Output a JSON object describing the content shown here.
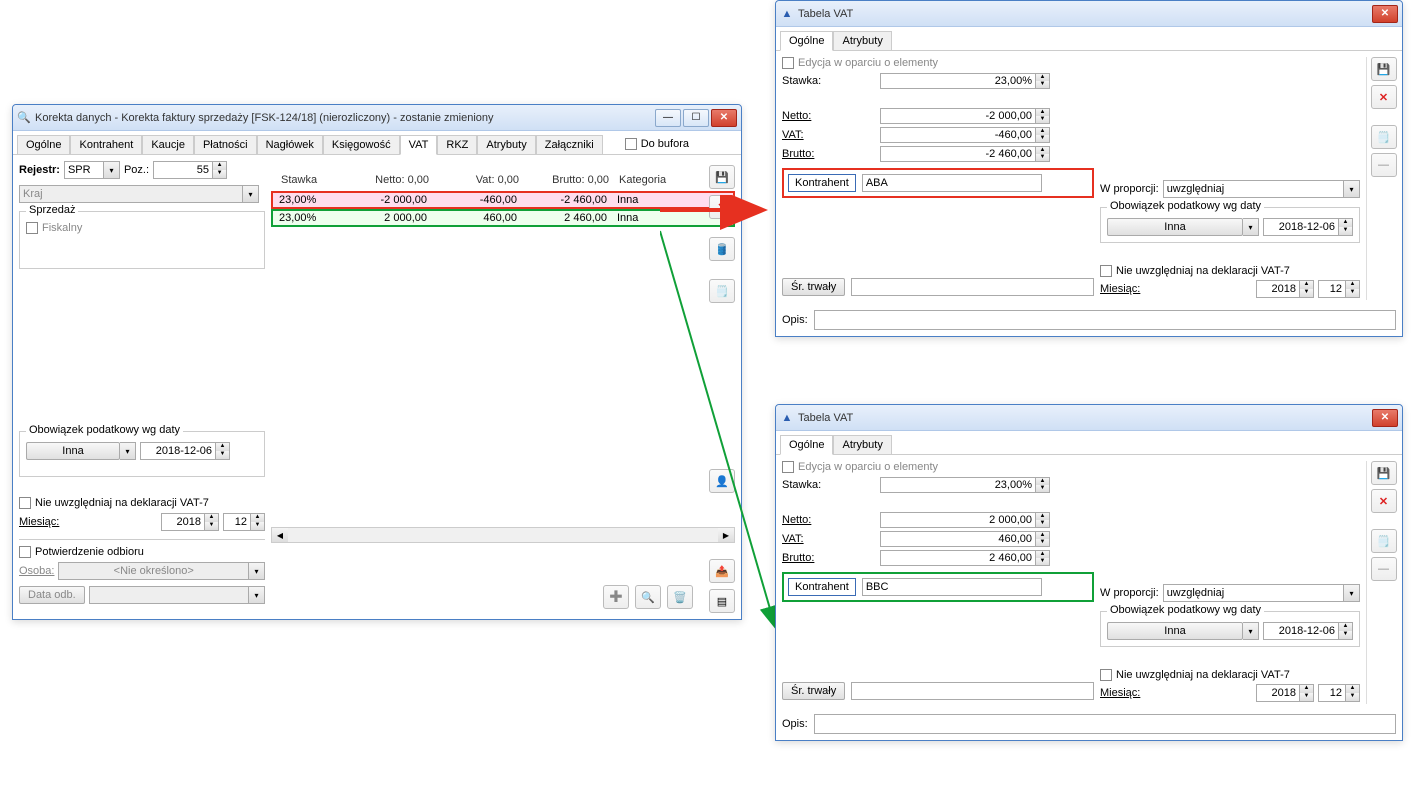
{
  "main_window": {
    "title": "Korekta danych - Korekta faktury sprzedaży [FSK-124/18] (nierozliczony) - zostanie zmieniony",
    "tabs": [
      "Ogólne",
      "Kontrahent",
      "Kaucje",
      "Płatności",
      "Nagłówek",
      "Księgowość",
      "VAT",
      "RKZ",
      "Atrybuty",
      "Załączniki"
    ],
    "active_tab": "VAT",
    "do_bufora": "Do bufora",
    "rejestr_label": "Rejestr:",
    "rejestr_value": "SPR",
    "poz_label": "Poz.:",
    "poz_value": "55",
    "kraj_label": "Kraj",
    "sprzedaz_title": "Sprzedaż",
    "fiskalny_label": "Fiskalny",
    "obowiazek_title": "Obowiązek podatkowy wg daty",
    "inna_option": "Inna",
    "date_value": "2018-12-06",
    "nie_uwzgledniaj": "Nie uwzględniaj na deklaracji VAT-7",
    "miesiac_label": "Miesiąc:",
    "miesiac_year": "2018",
    "miesiac_month": "12",
    "potwierdzenie_label": "Potwierdzenie odbioru",
    "osoba_label": "Osoba:",
    "osoba_value": "<Nie określono>",
    "data_odb_label": "Data odb.",
    "table_header": {
      "stawka": "Stawka",
      "netto": "Netto: 0,00",
      "vat": "Vat: 0,00",
      "brutto": "Brutto: 0,00",
      "kategoria": "Kategoria"
    },
    "rows": [
      {
        "stawka": "23,00%",
        "netto": "-2 000,00",
        "vat": "-460,00",
        "brutto": "-2 460,00",
        "kategoria": "Inna",
        "cls": "red"
      },
      {
        "stawka": "23,00%",
        "netto": "2 000,00",
        "vat": "460,00",
        "brutto": "2 460,00",
        "kategoria": "Inna",
        "cls": "green"
      }
    ]
  },
  "vat_win_title": "Tabela VAT",
  "vat_tabs": [
    "Ogólne",
    "Atrybuty"
  ],
  "vat1": {
    "edycja": "Edycja w oparciu o elementy",
    "stawka_label": "Stawka:",
    "stawka_value": "23,00%",
    "netto_label": "Netto:",
    "netto_value": "-2 000,00",
    "vat_label": "VAT:",
    "vat_value": "-460,00",
    "brutto_label": "Brutto:",
    "brutto_value": "-2 460,00",
    "kontrahent_btn": "Kontrahent",
    "kontrahent_value": "ABA",
    "sr_trwaly": "Śr. trwały",
    "opis_label": "Opis:",
    "proporcji_label": "W proporcji:",
    "proporcji_value": "uwzględniaj",
    "obowiazek": "Obowiązek podatkowy wg daty",
    "inna_option": "Inna",
    "date": "2018-12-06",
    "nie_uwzg": "Nie uwzględniaj na deklaracji VAT-7",
    "miesiac_label": "Miesiąc:",
    "year": "2018",
    "month": "12"
  },
  "vat2": {
    "edycja": "Edycja w oparciu o elementy",
    "stawka_label": "Stawka:",
    "stawka_value": "23,00%",
    "netto_label": "Netto:",
    "netto_value": "2 000,00",
    "vat_label": "VAT:",
    "vat_value": "460,00",
    "brutto_label": "Brutto:",
    "brutto_value": "2 460,00",
    "kontrahent_btn": "Kontrahent",
    "kontrahent_value": "BBC",
    "sr_trwaly": "Śr. trwały",
    "opis_label": "Opis:",
    "proporcji_label": "W proporcji:",
    "proporcji_value": "uwzględniaj",
    "obowiazek": "Obowiązek podatkowy wg daty",
    "inna_option": "Inna",
    "date": "2018-12-06",
    "nie_uwzg": "Nie uwzględniaj na deklaracji VAT-7",
    "miesiac_label": "Miesiąc:",
    "year": "2018",
    "month": "12"
  }
}
